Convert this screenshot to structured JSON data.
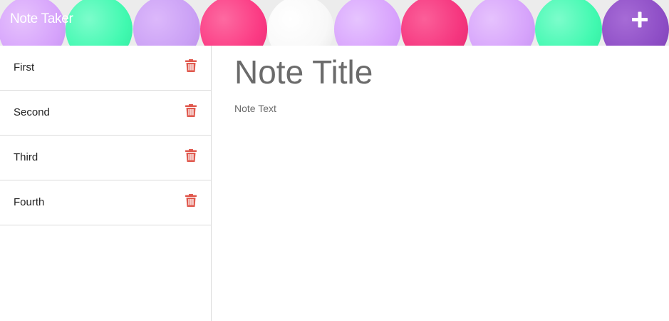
{
  "navbar": {
    "brand": "Note Taker",
    "add_icon": "plus-icon",
    "bubble_colors": [
      "#d6a3fb",
      "#41f9b0",
      "#caa0f5",
      "#fb3a83",
      "#ffffff",
      "#d8a3fd",
      "#f5357e",
      "#d6a3fb",
      "#41f9b0",
      "#8e4ec6"
    ]
  },
  "sidebar": {
    "notes": [
      {
        "label": "First",
        "icon": "trash-icon"
      },
      {
        "label": "Second",
        "icon": "trash-icon"
      },
      {
        "label": "Third",
        "icon": "trash-icon"
      },
      {
        "label": "Fourth",
        "icon": "trash-icon"
      }
    ]
  },
  "editor": {
    "title_placeholder": "Note Title",
    "text_placeholder": "Note Text"
  },
  "colors": {
    "trash": "#e05a4f",
    "text_muted": "#6b6b6b"
  }
}
